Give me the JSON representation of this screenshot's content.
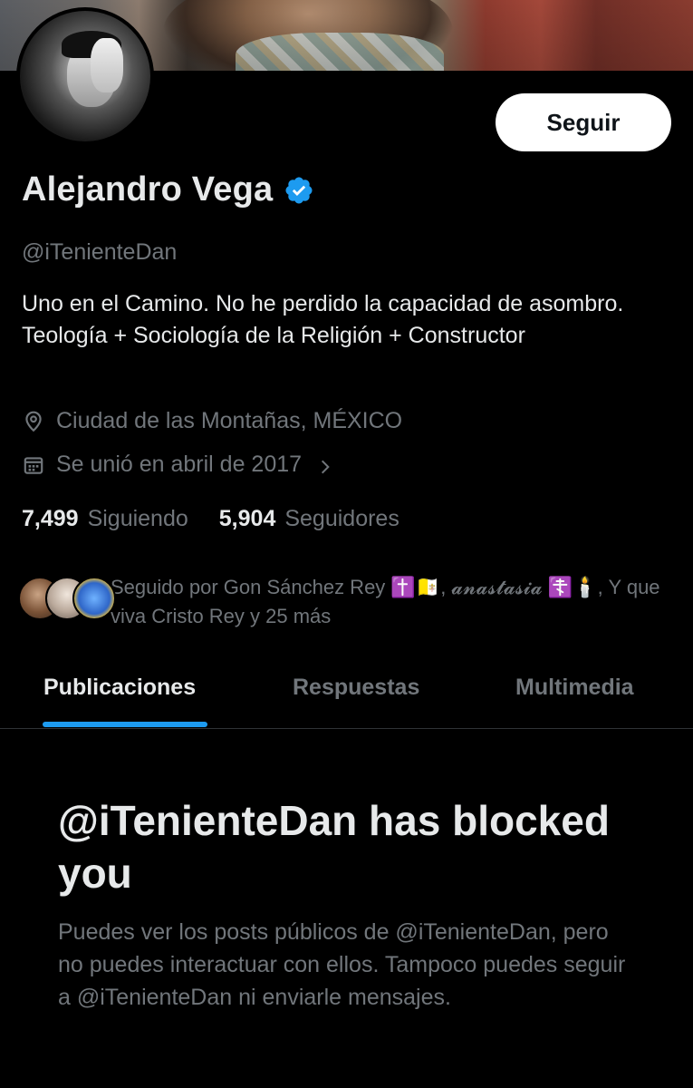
{
  "profile": {
    "name": "Alejandro Vega",
    "handle": "@iTenienteDan",
    "bio": "Uno en el Camino. No he perdido la capacidad de asombro. Teología + Sociología de la Religión + Constructor",
    "location": "Ciudad de las Montañas, MÉXICO",
    "joined": "Se unió en abril de 2017",
    "verified": true,
    "follow_button_label": "Seguir"
  },
  "stats": {
    "following_count": "7,499",
    "following_label": "Siguiendo",
    "followers_count": "5,904",
    "followers_label": "Seguidores"
  },
  "followed_by": {
    "line1": "Seguido por Gon Sánchez Rey ✝️🇻🇦, 𝓪𝓷𝓪𝓼𝓽𝓪𝓼𝓲𝓪 ☦️🕯️, Y que",
    "line2": "viva Cristo Rey y 25 más"
  },
  "tabs": [
    {
      "label": "Publicaciones",
      "active": true
    },
    {
      "label": "Respuestas",
      "active": false
    },
    {
      "label": "Multimedia",
      "active": false
    }
  ],
  "blocked": {
    "title": "@iTenienteDan has blocked you",
    "message": "Puedes ver los posts públicos de @iTenienteDan, pero no puedes interactuar con ellos. Tampoco puedes seguir a @iTenienteDan ni enviarle mensajes."
  },
  "icons": {
    "verified": "verified-badge-icon",
    "location": "location-pin-icon",
    "calendar": "calendar-icon",
    "chevron": "chevron-right-icon"
  },
  "colors": {
    "background": "#000000",
    "text_primary": "#e7e9ea",
    "text_secondary": "#71767b",
    "accent": "#1d9bf0",
    "button_bg": "#ffffff"
  }
}
